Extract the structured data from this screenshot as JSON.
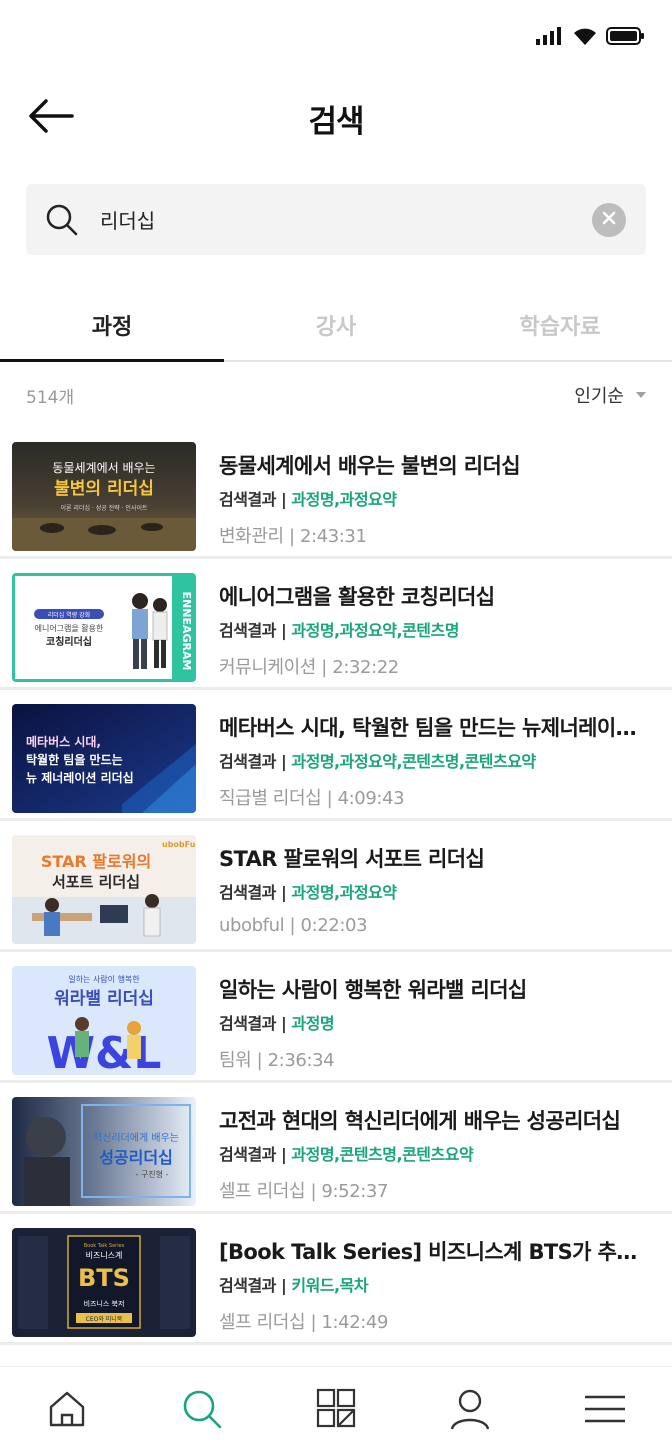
{
  "header": {
    "title": "검색"
  },
  "search": {
    "value": "리더십"
  },
  "tabs": [
    {
      "label": "과정",
      "active": true
    },
    {
      "label": "강사",
      "active": false
    },
    {
      "label": "학습자료",
      "active": false
    }
  ],
  "filter": {
    "count": "514개",
    "sort_label": "인기순"
  },
  "results": [
    {
      "title": "동물세계에서 배우는 불변의 리더십",
      "result_label": "검색결과 | ",
      "matches": "과정명,과정요약",
      "meta": "변화관리 | 2:43:31",
      "thumb_lines": [
        "동물세계에서 배우는",
        "불변의 리더십",
        "이론 리더십 · 성공 전략 · 인사이트"
      ]
    },
    {
      "title": "에니어그램을 활용한 코칭리더십",
      "result_label": "검색결과 | ",
      "matches": "과정명,과정요약,콘텐츠명",
      "meta": "커뮤니케이션 | 2:32:22",
      "thumb_lines": [
        "리더십 역량 강화",
        "에니어그램을 활용한",
        "코칭리더십",
        "ENNEAGRAM"
      ]
    },
    {
      "title": "메타버스 시대, 탁월한 팀을 만드는 뉴제너레이션 리더십",
      "result_label": "검색결과 | ",
      "matches": "과정명,과정요약,콘텐츠명,콘텐츠요약",
      "meta": "직급별 리더십 | 4:09:43",
      "thumb_lines": [
        "메타버스 시대,",
        "탁월한 팀을 만드는",
        "뉴 제너레이션 리더십"
      ]
    },
    {
      "title": "STAR 팔로워의 서포트 리더십",
      "result_label": "검색결과 | ",
      "matches": "과정명,과정요약",
      "meta": "ubobful | 0:22:03",
      "thumb_lines": [
        "STAR 팔로워의",
        "서포트 리더십",
        "ubobFul"
      ]
    },
    {
      "title": "일하는 사람이 행복한 워라밸 리더십",
      "result_label": "검색결과 | ",
      "matches": "과정명",
      "meta": "팀워 | 2:36:34",
      "thumb_lines": [
        "일하는 사람이 행복한",
        "워라밸 리더십",
        "W&L"
      ]
    },
    {
      "title": "고전과 현대의 혁신리더에게 배우는 성공리더십",
      "result_label": "검색결과 | ",
      "matches": "과정명,콘텐츠명,콘텐츠요약",
      "meta": "셀프 리더십 | 9:52:37",
      "thumb_lines": [
        "혁신리더에게 배우는",
        "성공리더십",
        "- 구진형 -"
      ]
    },
    {
      "title": "[Book Talk Series] 비즈니스계 BTS가 추천하는 책",
      "result_label": "검색결과 | ",
      "matches": "키워드,목차",
      "meta": "셀프 리더십 | 1:42:49",
      "thumb_lines": [
        "Book Talk Series",
        "비즈니스계",
        "BTS",
        "비즈니스 북저",
        "CEO와 미니북"
      ]
    }
  ],
  "nav": [
    "home-icon",
    "search-icon",
    "category-grid-icon",
    "profile-icon",
    "menu-icon"
  ],
  "colors": {
    "accent": "#1aa57e",
    "active_nav": "#1aa57e"
  }
}
